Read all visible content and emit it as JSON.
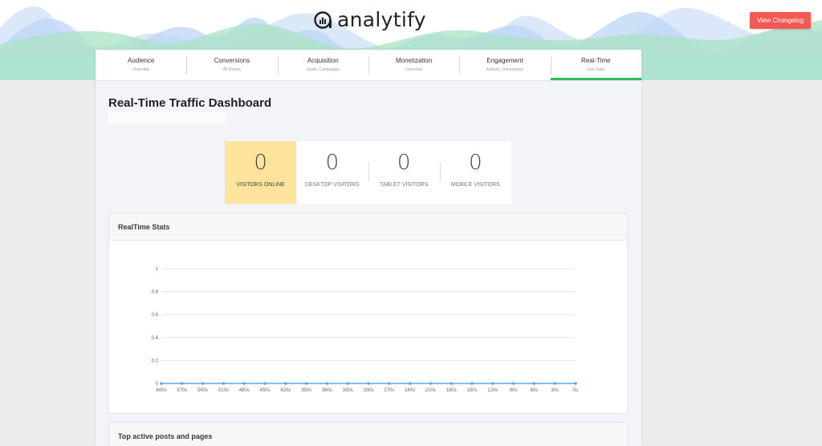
{
  "header": {
    "logo_text": "analytify",
    "changelog_button": "View Changelog"
  },
  "tabs": [
    {
      "title": "Audience",
      "sub": "Overview"
    },
    {
      "title": "Conversions",
      "sub": "All Events"
    },
    {
      "title": "Acquisition",
      "sub": "Goals, Campaigns"
    },
    {
      "title": "Monetization",
      "sub": "Overview"
    },
    {
      "title": "Engagement",
      "sub": "Authors, Dimensions"
    },
    {
      "title": "Real-Time",
      "sub": "Live Stats"
    }
  ],
  "active_tab": "Real-Time",
  "dashboard": {
    "title": "Real-Time Traffic Dashboard"
  },
  "counters": [
    {
      "value": "0",
      "label": "VISITORS ONLINE"
    },
    {
      "value": "0",
      "label": "DESKTOP VISITORS"
    },
    {
      "value": "0",
      "label": "TABLET VISITORS"
    },
    {
      "value": "0",
      "label": "MOBILE VISITORS"
    }
  ],
  "realtime_card": {
    "title": "RealTime Stats"
  },
  "pages_card": {
    "title": "Top active posts and pages"
  },
  "colors": {
    "accent_green": "#2bbd5b",
    "changelog_red": "#f15a52",
    "highlight_yellow": "#fde39b",
    "line_blue": "#5aa9e6"
  },
  "chart_data": {
    "type": "line",
    "x": [
      "600s",
      "570s",
      "540s",
      "510s",
      "480s",
      "450s",
      "420s",
      "390s",
      "360s",
      "330s",
      "300s",
      "270s",
      "240s",
      "210s",
      "180s",
      "150s",
      "120s",
      "90s",
      "60s",
      "30s",
      "0s"
    ],
    "series": [
      {
        "values": [
          0,
          0,
          0,
          0,
          0,
          0,
          0,
          0,
          0,
          0,
          0,
          0,
          0,
          0,
          0,
          0,
          0,
          0,
          0,
          0,
          0
        ]
      }
    ],
    "yticks": [
      "0",
      "0.2",
      "0.4",
      "0.6",
      "0.8",
      "1"
    ],
    "ylim": [
      0,
      1
    ],
    "grid": true
  }
}
